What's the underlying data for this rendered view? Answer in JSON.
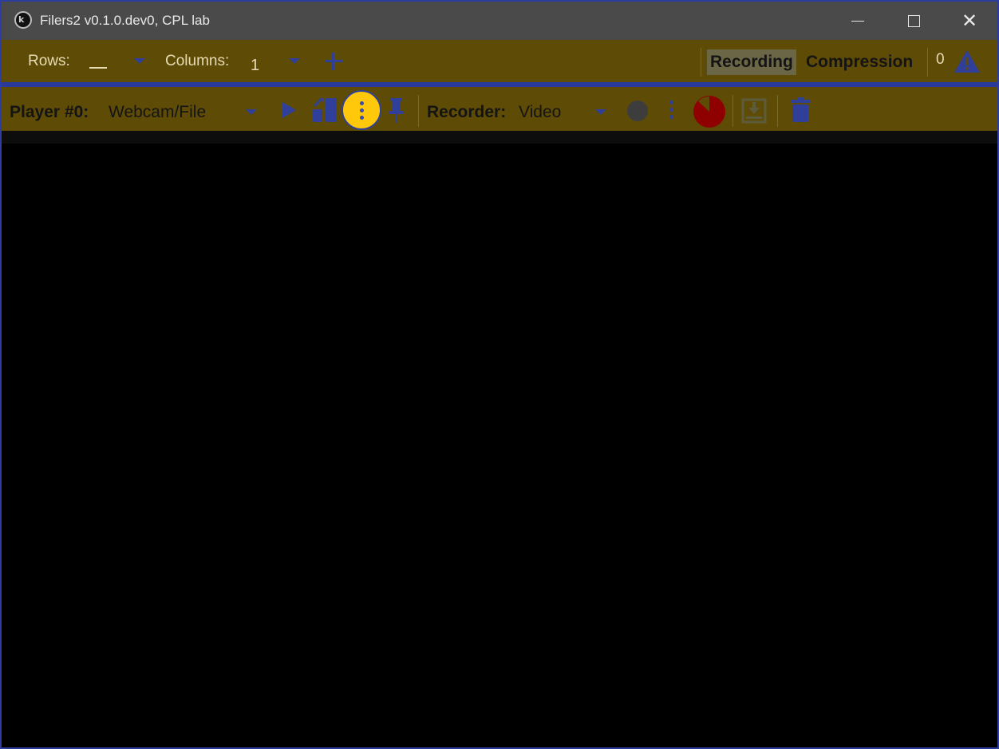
{
  "window": {
    "title": "Filers2 v0.1.0.dev0, CPL lab",
    "app_icon": "kivy-logo-icon",
    "close_glyph": "✕"
  },
  "grid_toolbar": {
    "rows_label": "Rows:",
    "rows_value": "",
    "columns_label": "Columns:",
    "columns_value": "1",
    "add_icon": "plus-icon",
    "tabs": {
      "recording": "Recording",
      "compression": "Compression"
    },
    "selected_tab": "Recording",
    "warning_count": "0",
    "warning_icon": "warning-triangle-icon"
  },
  "player_toolbar": {
    "player_label": "Player #0:",
    "player_source": "Webcam/File",
    "recorder_label": "Recorder:",
    "recorder_type": "Video",
    "icons": [
      "play-icon",
      "settings-icon",
      "more-vertical-icon",
      "pin-icon",
      "record-icon",
      "more-vertical-icon",
      "timer-icon",
      "save-icon",
      "delete-icon"
    ],
    "more_button_highlighted": true
  },
  "colors": {
    "toolbar_bg": "#5e4b05",
    "accent_blue": "#2f3f9a",
    "highlight_yellow": "#ffc80a",
    "timer_red": "#8f0000",
    "titlebar_bg": "#4a4a4a",
    "player_bg": "#000000"
  }
}
